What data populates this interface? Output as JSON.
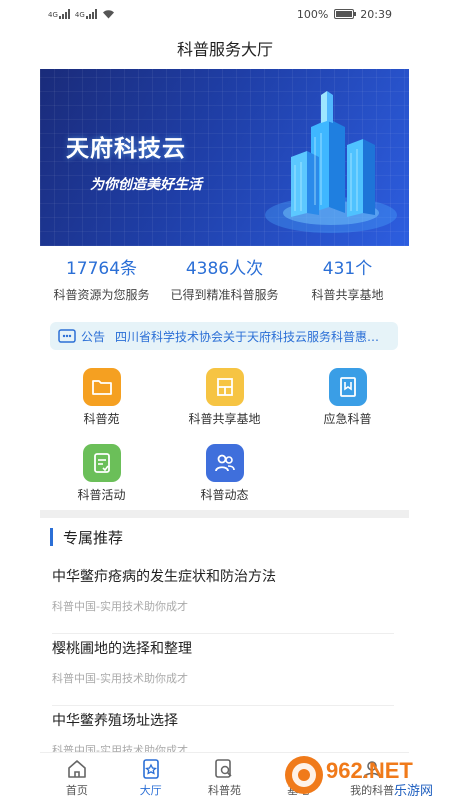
{
  "status_bar": {
    "signal_label_1": "4G",
    "signal_label_2": "4G",
    "battery": "100%",
    "battery_level": 1.0,
    "time": "20:39"
  },
  "header": {
    "title": "科普服务大厅"
  },
  "banner": {
    "title": "天府科技云",
    "slogan": "为你创造美好生活"
  },
  "stats": [
    {
      "value": "17764条",
      "label": "科普资源为您服务"
    },
    {
      "value": "4386人次",
      "label": "已得到精准科普服务"
    },
    {
      "value": "431个",
      "label": "科普共享基地"
    }
  ],
  "notice": {
    "tag": "公告",
    "text": "四川省科学技术协会关于天府科技云服务科普惠民..."
  },
  "menu": [
    {
      "label": "科普苑",
      "icon": "folder-icon",
      "color": "#f5a021"
    },
    {
      "label": "科普共享基地",
      "icon": "grid-blocks-icon",
      "color": "#f6c443"
    },
    {
      "label": "应急科普",
      "icon": "bookmark-icon",
      "color": "#3a9ee6"
    },
    {
      "label": "科普活动",
      "icon": "clipboard-icon",
      "color": "#6bbf59"
    },
    {
      "label": "科普动态",
      "icon": "people-icon",
      "color": "#3f6fdc"
    }
  ],
  "recommend": {
    "title": "专属推荐",
    "items": [
      {
        "title": "中华鳖疖疮病的发生症状和防治方法",
        "source": "科普中国-实用技术助你成才"
      },
      {
        "title": "樱桃圃地的选择和整理",
        "source": "科普中国-实用技术助你成才"
      },
      {
        "title": "中华鳖养殖场址选择",
        "source": "科普中国-实用技术助你成才"
      }
    ]
  },
  "tabs": [
    {
      "label": "首页",
      "icon": "home-icon",
      "active": false
    },
    {
      "label": "大厅",
      "icon": "star-bookmark-icon",
      "active": true
    },
    {
      "label": "科普苑",
      "icon": "search-doc-icon",
      "active": false
    },
    {
      "label": "基地",
      "icon": "star-circle-icon",
      "active": false
    },
    {
      "label": "我的科普",
      "icon": "user-icon",
      "active": false
    }
  ],
  "watermark": {
    "brand": "962.NET",
    "sub": "乐游网"
  },
  "colors": {
    "accent": "#2b6fd6",
    "notice_bg": "#e6f3f8",
    "banner_dark": "#1a2b7a"
  }
}
